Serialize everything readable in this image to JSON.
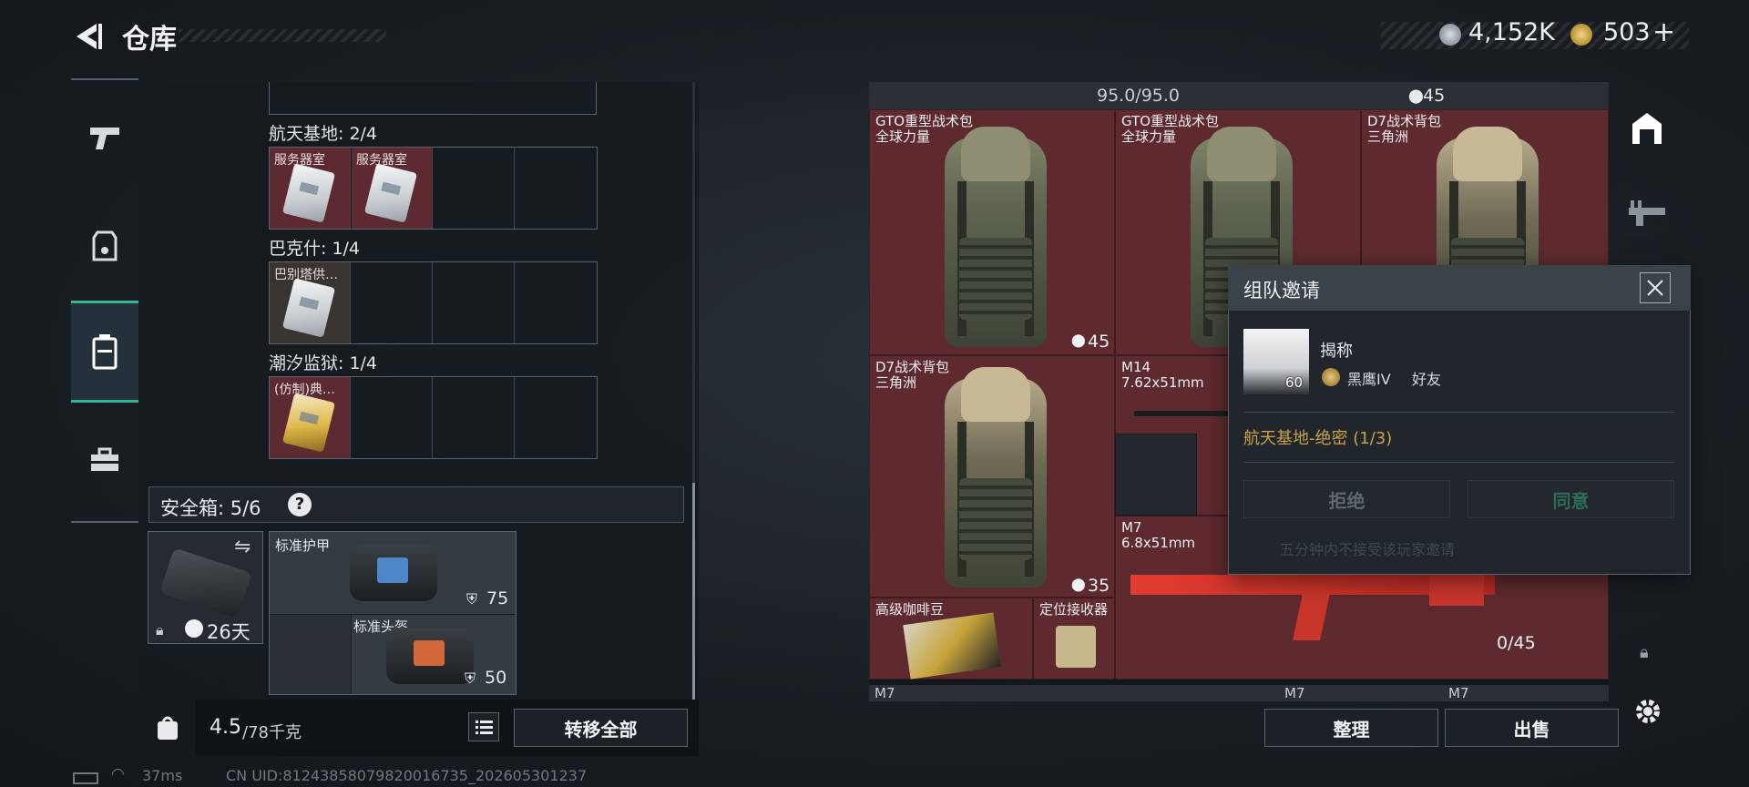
{
  "header": {
    "back_icon": "back-arrow-icon",
    "title": "仓库",
    "currency_silver": "4,152K",
    "currency_gold": "503",
    "plus": "+"
  },
  "left_rail": {
    "items": [
      {
        "icon": "pistol-icon",
        "active": false
      },
      {
        "icon": "backpack-vest-icon",
        "active": false
      },
      {
        "icon": "case-icon",
        "active": true
      },
      {
        "icon": "toolbox-icon",
        "active": false
      }
    ]
  },
  "keys": {
    "groups": [
      {
        "label": "航天基地: 2/4",
        "cells": [
          "服务器室",
          "服务器室",
          "",
          ""
        ]
      },
      {
        "label": "巴克什: 1/4",
        "cells": [
          "巴别塔供…",
          "",
          "",
          ""
        ]
      },
      {
        "label": "潮汐监狱: 1/4",
        "cells": [
          "(仿制)典…",
          "",
          "",
          ""
        ]
      }
    ]
  },
  "safe_box": {
    "label": "安全箱: 5/6",
    "help": "?",
    "days": "26天",
    "items": [
      {
        "name": "标准护甲",
        "durability": "75"
      },
      {
        "name": "标准头盔",
        "durability": "50"
      }
    ]
  },
  "capacity": {
    "current": "4.5",
    "max": "/78千克"
  },
  "buttons": {
    "transfer_all": "转移全部",
    "sort": "整理",
    "sell": "出售"
  },
  "status_bar": {
    "ping": "37ms",
    "uid": "CN UID:81243858079820016735_202605301237"
  },
  "stash": {
    "durability": "95.0/95.0",
    "top_count": "45",
    "items": [
      {
        "name": "GTO重型战术包\n全球力量"
      },
      {
        "name": "GTO重型战术包\n全球力量",
        "count": "45"
      },
      {
        "name": "D7战术背包\n三角洲"
      },
      {
        "name": "D7战术背包\n三角洲",
        "count": "35"
      },
      {
        "name": "M14\n7.62x51mm"
      },
      {
        "name": "M7\n6.8x51mm"
      },
      {
        "name": "高级咖啡豆"
      },
      {
        "name": "定位接收器"
      },
      {
        "ammo": "0/45"
      }
    ],
    "bottom_labels": [
      "M7",
      "M7",
      "M7"
    ]
  },
  "invite_dialog": {
    "title": "组队邀请",
    "player_name": "揭称",
    "player_level": "60",
    "rank": "黑鹰IV",
    "relation": "好友",
    "mode": "航天基地-绝密 (1/3)",
    "reject": "拒绝",
    "accept": "同意",
    "footer": "五分钟内不接受该玩家邀请"
  },
  "colors": {
    "accent_green": "#2fb98f",
    "item_red": "#5e2a2f",
    "mode_gold": "#c9a24a"
  }
}
